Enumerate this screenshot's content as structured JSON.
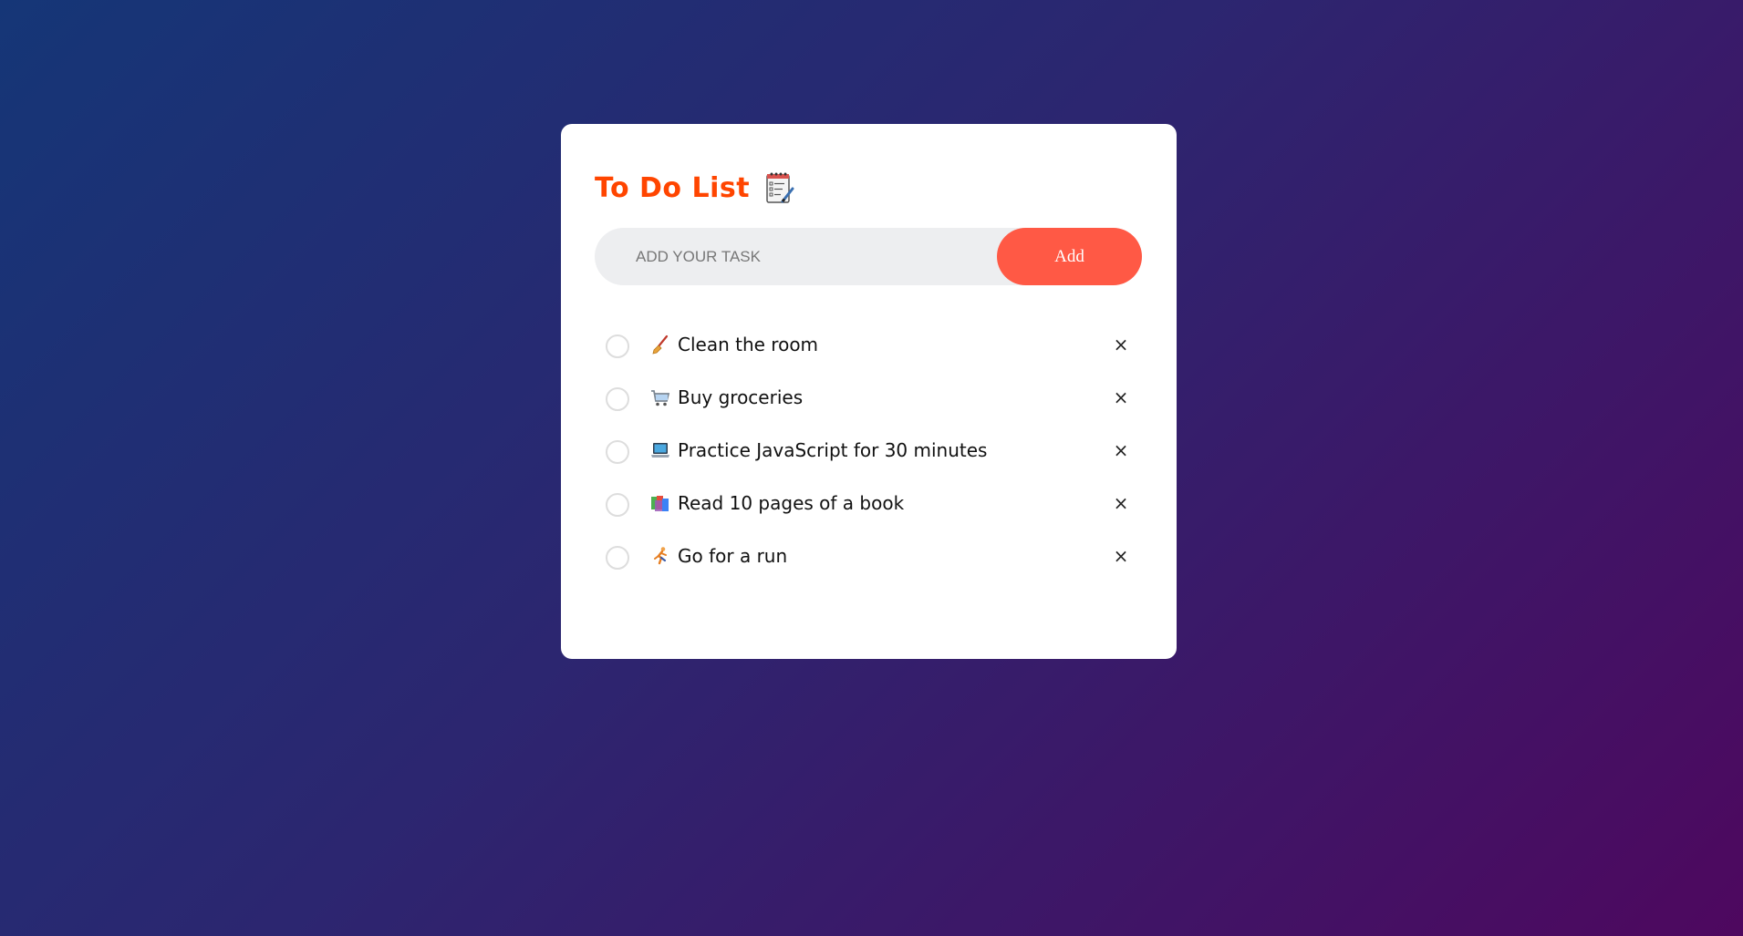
{
  "app": {
    "title": "To Do List",
    "title_icon": "notepad-icon"
  },
  "input": {
    "placeholder": "ADD YOUR TASK",
    "value": ""
  },
  "add_button": {
    "label": "Add"
  },
  "tasks": [
    {
      "emoji_icon": "broom-icon",
      "text": "Clean the room",
      "checked": false,
      "delete_label": "×"
    },
    {
      "emoji_icon": "shopping-cart-icon",
      "text": "Buy groceries",
      "checked": false,
      "delete_label": "×"
    },
    {
      "emoji_icon": "laptop-icon",
      "text": "Practice JavaScript for 30 minutes",
      "checked": false,
      "delete_label": "×"
    },
    {
      "emoji_icon": "books-icon",
      "text": "Read 10 pages of a book",
      "checked": false,
      "delete_label": "×"
    },
    {
      "emoji_icon": "runner-icon",
      "text": "Go for a run",
      "checked": false,
      "delete_label": "×"
    }
  ],
  "colors": {
    "accent": "#ff4500",
    "button": "#ff5945",
    "input_bg": "#edeef0",
    "gradient_start": "#153677",
    "gradient_end": "#4e085f"
  }
}
